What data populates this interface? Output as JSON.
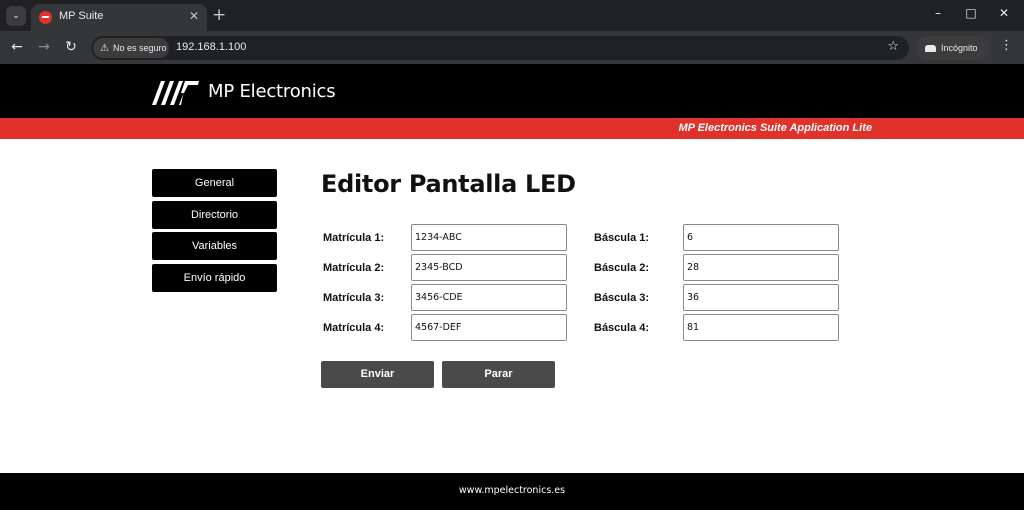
{
  "browser": {
    "tab_title": "MP Suite",
    "security_label": "No es seguro",
    "url": "192.168.1.100",
    "incognito_label": "Incógnito",
    "icons": [
      "tab-search-icon",
      "favicon",
      "close-icon",
      "new-tab-icon",
      "minimize-icon",
      "maximize-icon",
      "window-close-icon",
      "back-icon",
      "forward-icon",
      "reload-icon",
      "warning-icon",
      "bookmark-star-icon",
      "incognito-icon",
      "kebab-menu-icon"
    ]
  },
  "header": {
    "brand": "MP Electronics",
    "tagline": "MP Electronics Suite Application Lite"
  },
  "sidebar": {
    "items": [
      {
        "label": "General"
      },
      {
        "label": "Directorio"
      },
      {
        "label": "Variables"
      },
      {
        "label": "Envío rápido"
      }
    ]
  },
  "main": {
    "title": "Editor Pantalla LED",
    "matriculas": [
      {
        "label": "Matrícula 1:",
        "value": "1234-ABC"
      },
      {
        "label": "Matrícula 2:",
        "value": "2345-BCD"
      },
      {
        "label": "Matrícula 3:",
        "value": "3456-CDE"
      },
      {
        "label": "Matrícula 4:",
        "value": "4567-DEF"
      }
    ],
    "basculas": [
      {
        "label": "Báscula 1:",
        "value": "6"
      },
      {
        "label": "Báscula 2:",
        "value": "28"
      },
      {
        "label": "Báscula 3:",
        "value": "36"
      },
      {
        "label": "Báscula 4:",
        "value": "81"
      }
    ],
    "send_label": "Enviar",
    "stop_label": "Parar"
  },
  "footer": {
    "text": "www.mpelectronics.es"
  },
  "colors": {
    "brand_red": "#e0312a",
    "header_bg": "#000000",
    "button_gray": "#4a4a4a"
  }
}
